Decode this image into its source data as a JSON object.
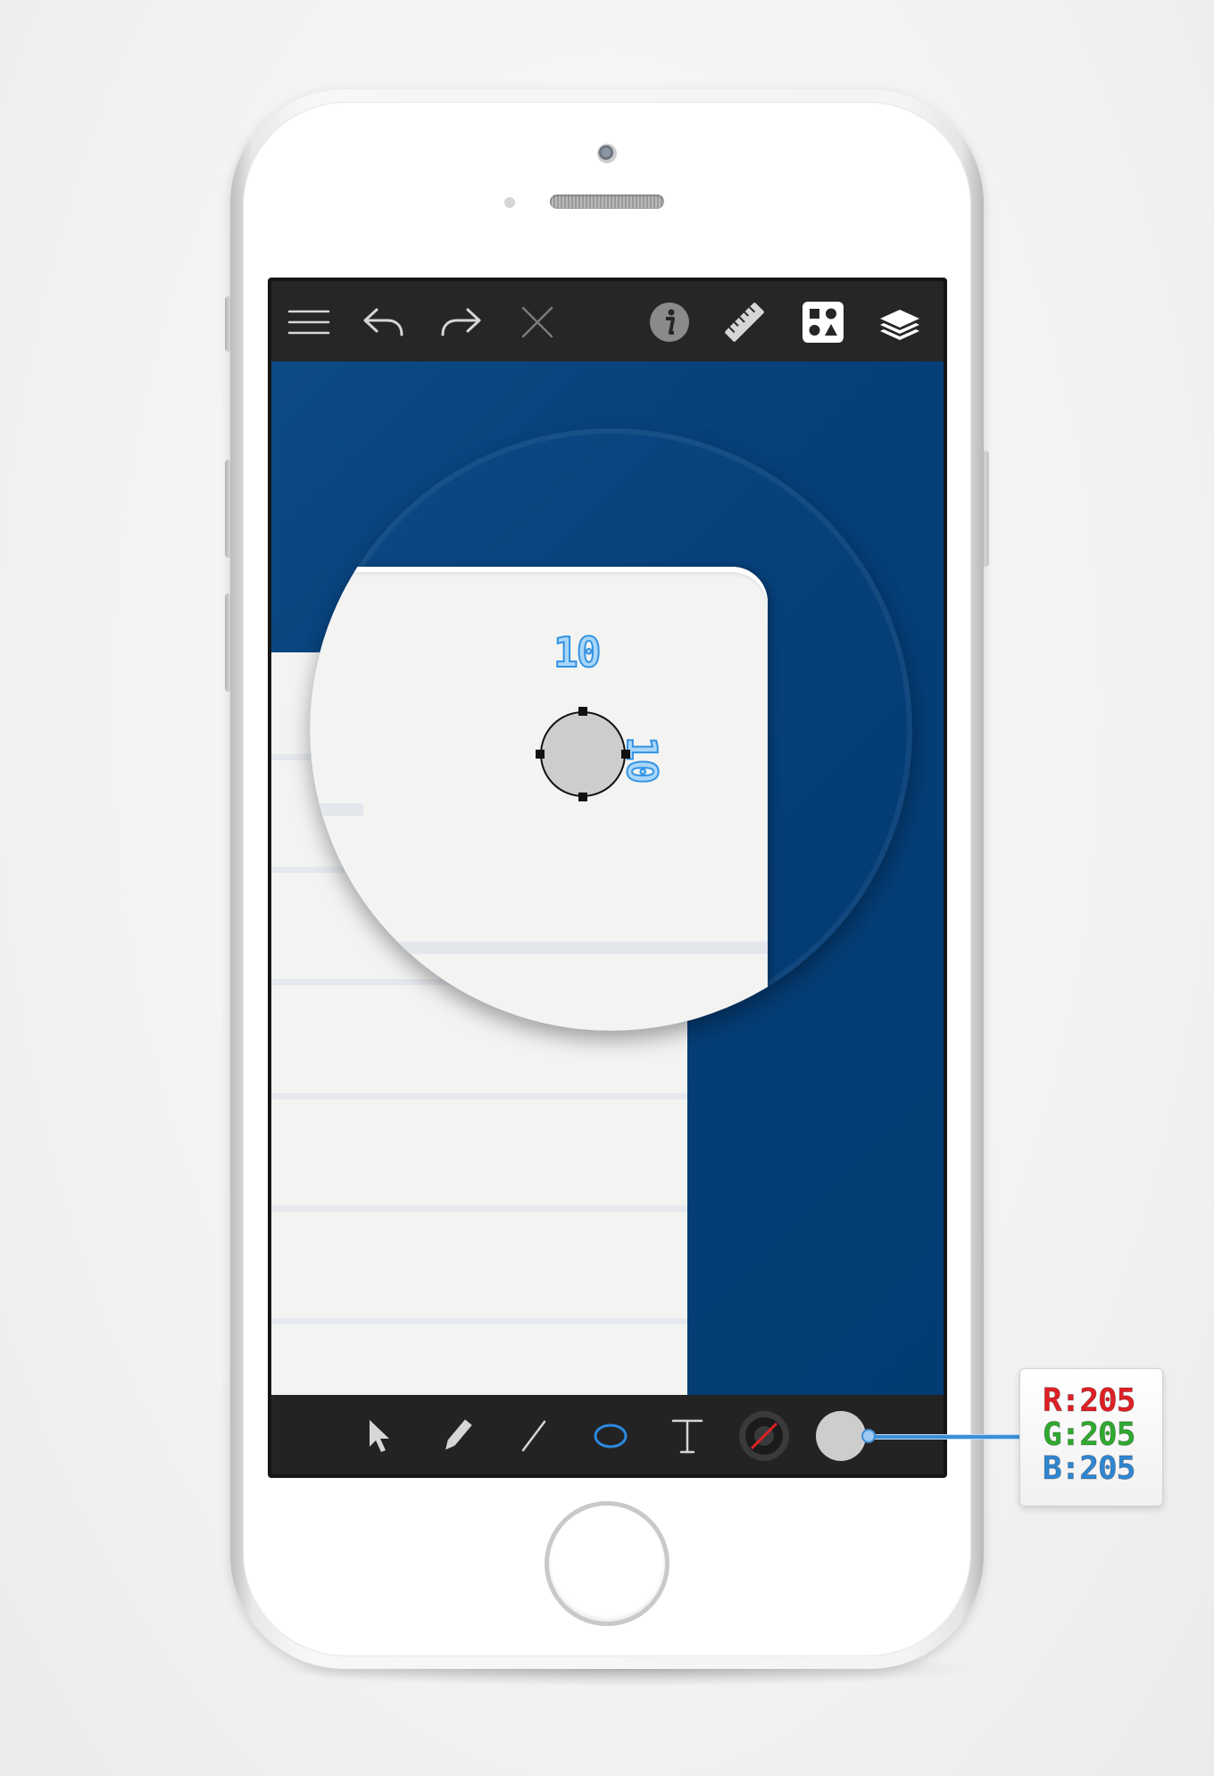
{
  "toolbar_top": {
    "icons": [
      "menu-icon",
      "undo-icon",
      "redo-icon",
      "close-icon",
      "info-icon",
      "ruler-icon",
      "shapes-icon",
      "layers-icon"
    ]
  },
  "toolbar_bottom": {
    "tools": [
      {
        "name": "select",
        "icon": "arrow-pointer-icon",
        "active": false
      },
      {
        "name": "pencil",
        "icon": "pencil-icon",
        "active": false
      },
      {
        "name": "line",
        "icon": "line-icon",
        "active": false
      },
      {
        "name": "ellipse",
        "icon": "ellipse-icon",
        "active": true
      },
      {
        "name": "text",
        "icon": "text-tool-icon",
        "label": "T",
        "active": false
      }
    ],
    "stroke_swatch": "none",
    "fill_swatch": "#cdcdcd"
  },
  "canvas": {
    "background_color": "#033b73",
    "document_color": "#f3f4f2",
    "selected_shape": {
      "type": "ellipse",
      "width": "10",
      "height": "10",
      "fill": "#cdcdcd"
    }
  },
  "color_readout": {
    "r": "R:205",
    "g": "G:205",
    "b": "B:205"
  },
  "colors": {
    "accent": "#3d8fd6",
    "toolbar": "#262626",
    "active_tool": "#2b8ae0"
  }
}
